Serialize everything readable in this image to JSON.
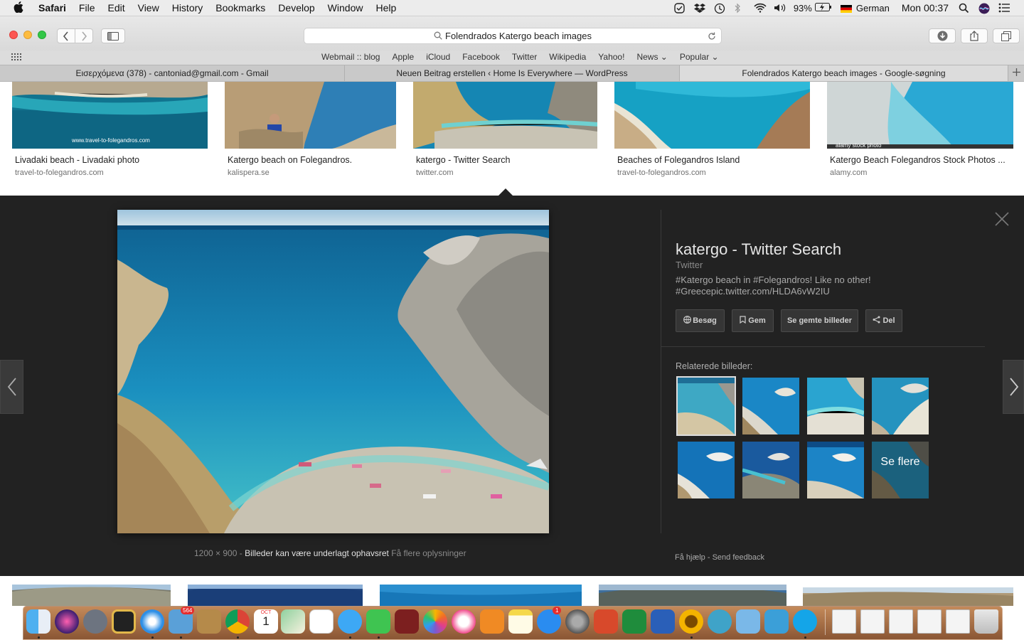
{
  "menubar": {
    "apple": "",
    "menus": [
      "Safari",
      "File",
      "Edit",
      "View",
      "History",
      "Bookmarks",
      "Develop",
      "Window",
      "Help"
    ],
    "battery": "93%",
    "input_language": "German",
    "clock": "Mon 00:37"
  },
  "toolbar": {
    "url_text": "Folendrados Katergo beach images"
  },
  "favorites": [
    "Webmail :: blog",
    "Apple",
    "iCloud",
    "Facebook",
    "Twitter",
    "Wikipedia",
    "Yahoo!",
    "News ⌄",
    "Popular ⌄"
  ],
  "tabs": [
    {
      "label": "Εισερχόμενα (378) - cantoniad@gmail.com - Gmail",
      "active": false
    },
    {
      "label": "Neuen Beitrag erstellen ‹ Home Is Everywhere — WordPress",
      "active": false
    },
    {
      "label": "Folendrados Katergo beach images - Google-søgning",
      "active": true
    }
  ],
  "results": [
    {
      "title": "Livadaki beach - Livadaki photo",
      "source": "travel-to-folegandros.com",
      "watermark": "www.travel-to-folegandros.com"
    },
    {
      "title": "Katergo beach on Folegandros.",
      "source": "kalispera.se"
    },
    {
      "title": "katergo - Twitter Search",
      "source": "twitter.com"
    },
    {
      "title": "Beaches of Folegandros Island",
      "source": "travel-to-folegandros.com"
    },
    {
      "title": "Katergo Beach Folegandros Stock Photos ...",
      "source": "alamy.com",
      "watermark": "alamy stock photo"
    }
  ],
  "viewer": {
    "title": "katergo - Twitter Search",
    "site": "Twitter",
    "description_line1": "#Katergo beach in #Folegandros! Like no other!",
    "description_line2": "#Greecepic.twitter.com/HLDA6vW2IU",
    "actions": [
      "Besøg",
      "Gem",
      "Se gemte billeder",
      "Del"
    ],
    "related_label": "Relaterede billeder:",
    "see_more": "Se flere",
    "dimensions": "1200 × 900",
    "sep": "-",
    "copyright": "Billeder kan være underlagt ophavsret",
    "more_info": "Få flere oplysninger",
    "help": "Få hjælp",
    "feedback": "Send feedback"
  },
  "dock": {
    "badge_mail": "564",
    "badge_appstore": "1",
    "calendar_month": "OCT",
    "calendar_day": "1"
  },
  "colors": {
    "panel": "#222222",
    "sea": "#1a8fbf",
    "dock": "#a86c44"
  }
}
